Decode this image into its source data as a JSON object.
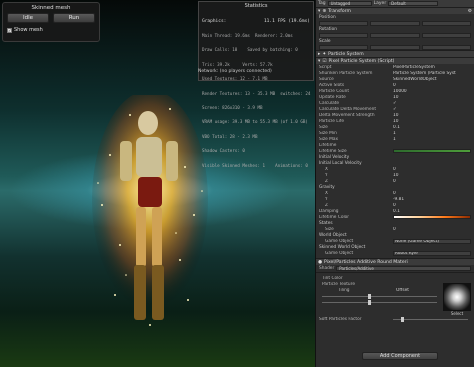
{
  "scene": {
    "panel": {
      "title": "Skinned mesh",
      "idle_label": "Idle",
      "run_label": "Run",
      "show_mesh_label": "Show mesh",
      "show_mesh_checked": true
    },
    "stats": {
      "title": "Statistics",
      "graphics_label": "Graphics:",
      "fps": "11.1 FPS (19.6ms)",
      "lines": [
        "Main Thread: 19.6ms  Renderer: 2.0ms",
        "Draw Calls: 18    Saved by batching: 0",
        "Tris: 39.2k     Verts: 57.7k",
        "Used Textures: 12 - 7.1 MB",
        "Render Textures: 13 - 35.3 MB  switches: 24",
        "Screen: 826x310 - 3.9 MB",
        "VRAM usage: 39.3 MB to 55.3 MB (of 1.0 GB)",
        "VBO Total: 28 - 2.3 MB",
        "Shadow Casters: 0",
        "Visible Skinned Meshes: 1    Animations: 0"
      ],
      "network_label": "Network: (no players connected)"
    }
  },
  "inspector": {
    "top": {
      "tag_label": "Tag",
      "tag_value": "Untagged",
      "layer_label": "Layer",
      "layer_value": "Default"
    },
    "transform": {
      "title": "Transform",
      "position_label": "Position",
      "rotation_label": "Rotation",
      "scale_label": "Scale"
    },
    "pixel_script": {
      "title": "Pixel Particle System (Script)",
      "rows": [
        {
          "label": "Script",
          "value": "PixelParticleSystem"
        },
        {
          "label": "Shuriken Particle System",
          "value": "Particle System (Particle Syst"
        },
        {
          "label": "Source",
          "value": "SkinnedWorldObject"
        },
        {
          "label": "Active Slots",
          "value": "0"
        },
        {
          "label": "Particle Count",
          "value": "10000"
        },
        {
          "label": "Update Rate",
          "value": "10"
        },
        {
          "label": "Calculate",
          "value": "✓"
        },
        {
          "label": "Calculate Delta Movement",
          "value": "✓"
        },
        {
          "label": "Delta Movement Strength",
          "value": "10"
        },
        {
          "label": "Particle Life",
          "value": "10"
        },
        {
          "label": "Size",
          "value": "0.1"
        },
        {
          "label": "Size Min",
          "value": "1"
        },
        {
          "label": "Size Max",
          "value": "1"
        }
      ],
      "lifetime_label": "Lifetime",
      "lifetime_size_label": "Lifetime Size",
      "initial_velocity_label": "Initial Velocity",
      "initial_local_velocity_label": "Initial Local Velocity",
      "ilv": [
        {
          "label": "X",
          "value": "0"
        },
        {
          "label": "Y",
          "value": "10"
        },
        {
          "label": "Z",
          "value": "0"
        }
      ],
      "gravity_label": "Gravity",
      "gravity": [
        {
          "label": "X",
          "value": "0"
        },
        {
          "label": "Y",
          "value": "-9.81"
        },
        {
          "label": "Z",
          "value": "0"
        }
      ],
      "damping_label": "Damping",
      "damping_value": "0.1",
      "lifetime_color_label": "Lifetime Color",
      "states_label": "States",
      "states_size_label": "Size",
      "states_size_value": "0",
      "world_object_label": "World Object",
      "world_object_go_label": "Game Object",
      "world_object_go_value": "None (Game Object)",
      "skinned_world_object_label": "Skinned World Object",
      "skinned_go_label": "Game Object",
      "skinned_go_value": "Robot Kyle"
    },
    "material": {
      "name": "Pixel/Particles Additive Round Materi",
      "shader_label": "Shader",
      "shader_value": "Particles/Additive",
      "tint_label": "Tint Color",
      "texture_label": "Particle Texture",
      "tiling_label": "Tiling",
      "offset_label": "Offset",
      "soft_label": "Soft Particles Factor",
      "select_label": "Select"
    },
    "add_component_label": "Add Component"
  }
}
